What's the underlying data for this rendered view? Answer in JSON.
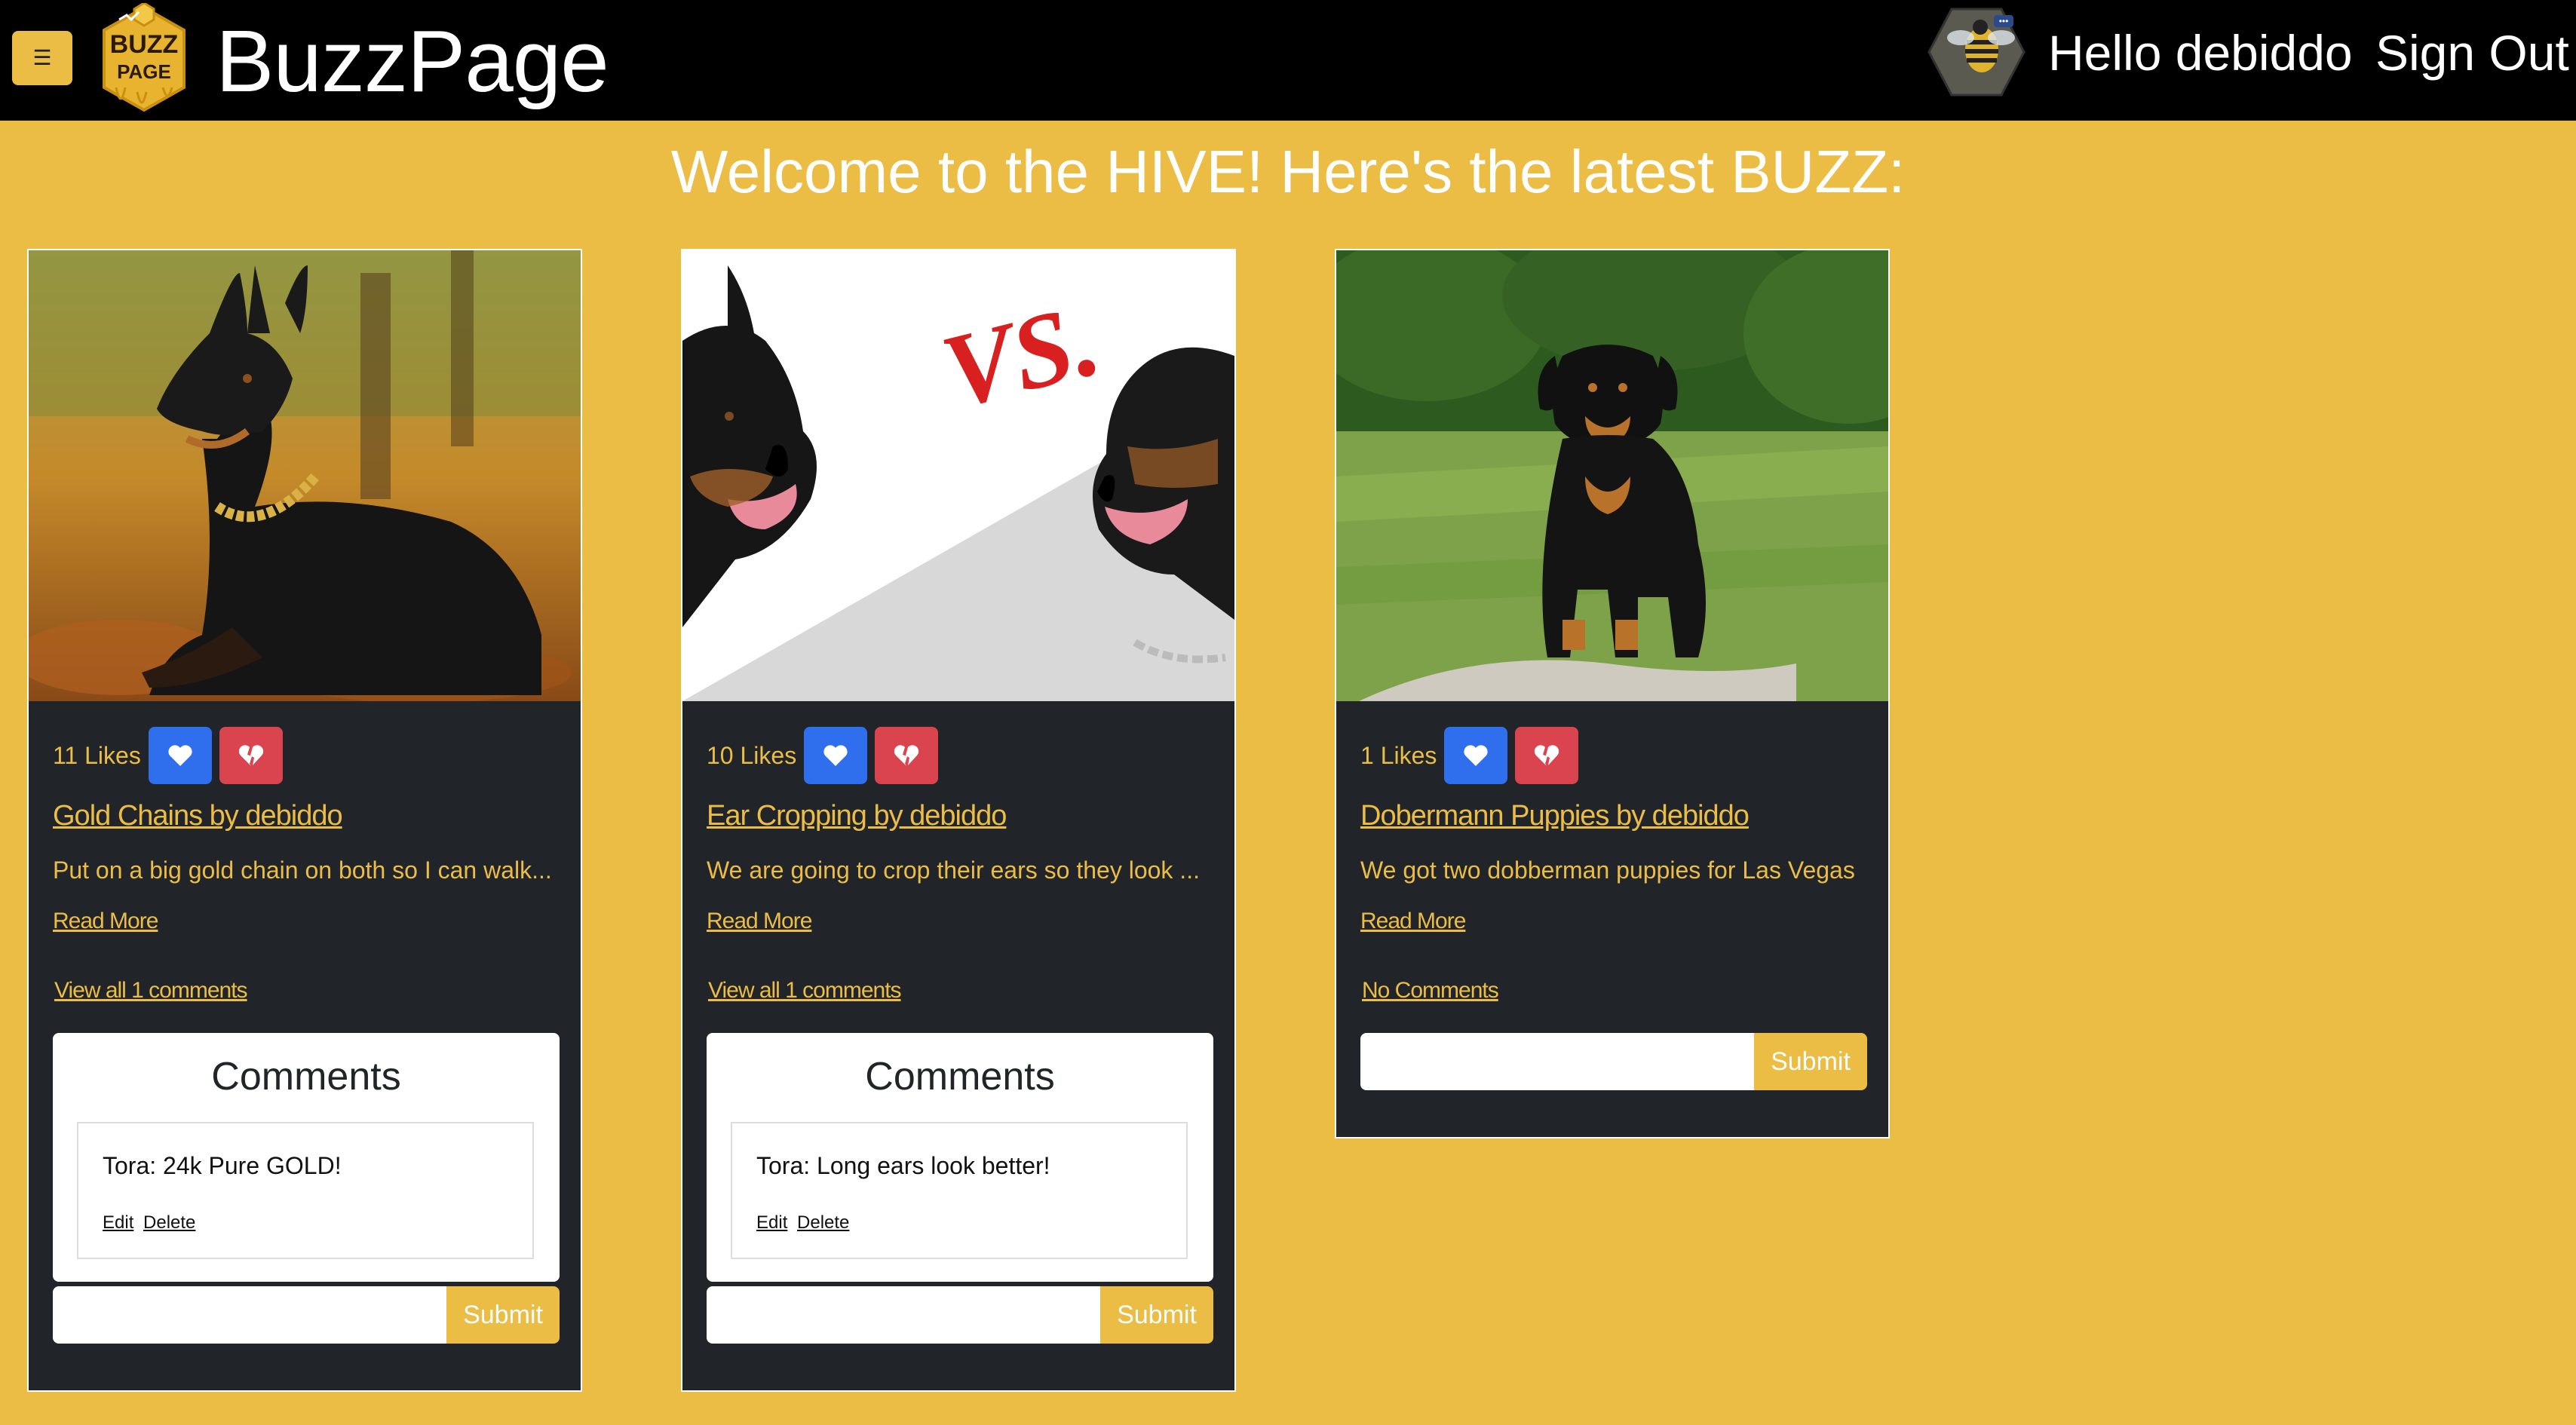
{
  "nav": {
    "menu_icon": "hamburger-icon",
    "logo_text_top": "BUZZ",
    "logo_text_bottom": "PAGE",
    "brand": "BuzzPage",
    "greeting": "Hello debiddo",
    "sign_out": "Sign Out"
  },
  "heading": "Welcome to the HIVE! Here's the latest BUZZ:",
  "colors": {
    "accent": "#ecbd45",
    "card_bg": "#212529",
    "like": "#2f6fed",
    "dislike": "#d9444e"
  },
  "posts": [
    {
      "likes": "11 Likes",
      "title": "Gold Chains by debiddo",
      "snippet": "Put on a big gold chain on both so I can walk...",
      "read_more": "Read More",
      "comments_link": "View all 1 comments",
      "comments_heading": "Comments",
      "comments": [
        {
          "text": "Tora: 24k Pure GOLD!",
          "edit": "Edit",
          "delete": "Delete"
        }
      ],
      "submit": "Submit"
    },
    {
      "likes": "10 Likes",
      "title": "Ear Cropping by debiddo",
      "snippet": "We are going to crop their ears so they look ...",
      "read_more": "Read More",
      "comments_link": "View all 1 comments",
      "comments_heading": "Comments",
      "comments": [
        {
          "text": "Tora: Long ears look better!",
          "edit": "Edit",
          "delete": "Delete"
        }
      ],
      "submit": "Submit",
      "image_text": "VS."
    },
    {
      "likes": "1 Likes",
      "title": "Dobermann Puppies by debiddo",
      "snippet": "We got two dobberman puppies for Las Vegas",
      "read_more": "Read More",
      "comments_link": "No Comments",
      "submit": "Submit"
    }
  ]
}
